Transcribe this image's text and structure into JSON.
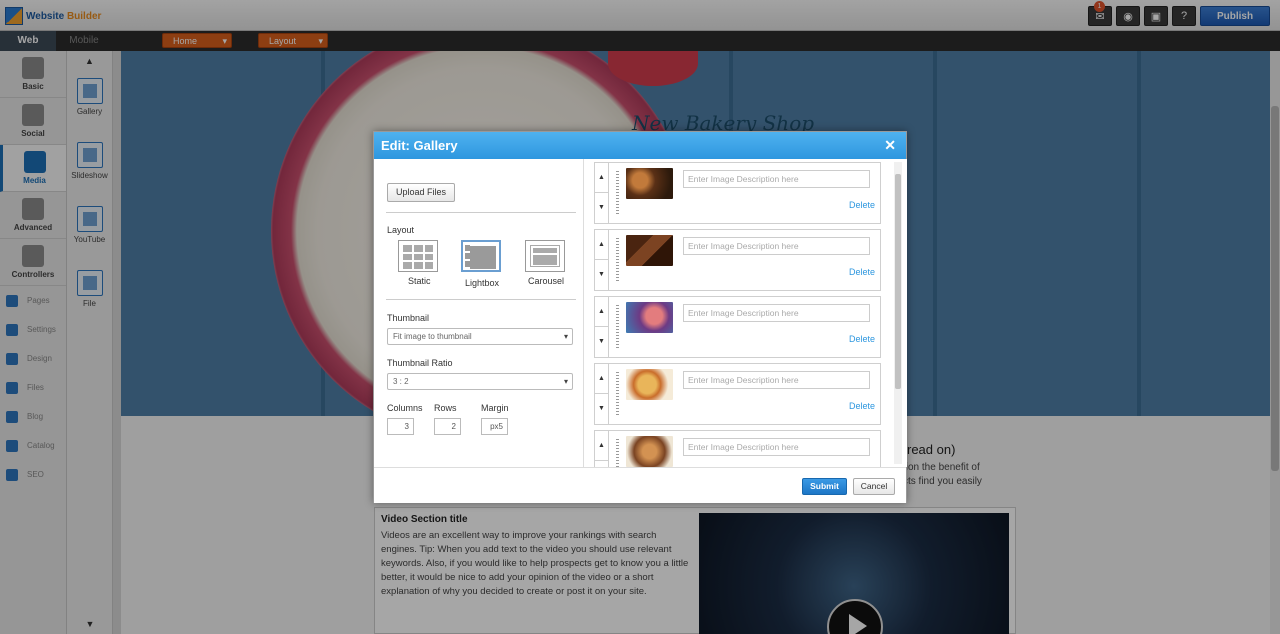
{
  "app": {
    "name_a": "Website",
    "name_b": "Builder",
    "notification_count": "1",
    "publish_label": "Publish"
  },
  "navbar": {
    "tabs": [
      "Web",
      "Mobile"
    ],
    "page_dropdown": "Home",
    "layout_dropdown": "Layout"
  },
  "sidebar": {
    "main": [
      {
        "label": "Basic",
        "icon": "flag-icon"
      },
      {
        "label": "Social",
        "icon": "chat-icon"
      },
      {
        "label": "Media",
        "icon": "media-icon",
        "active": true
      },
      {
        "label": "Advanced",
        "icon": "tools-icon"
      },
      {
        "label": "Controllers",
        "icon": "box-icon"
      }
    ],
    "links": [
      "Pages",
      "Settings",
      "Design",
      "Files",
      "Blog",
      "Catalog",
      "SEO"
    ],
    "media_items": [
      "Gallery",
      "Slideshow",
      "YouTube",
      "File"
    ]
  },
  "page": {
    "hero_title": "New Bakery Shop",
    "read_on": "read on)",
    "read_on_line1": "tion the benefit of",
    "read_on_line2": "cts find you easily",
    "video_title": "Video Section title",
    "video_text": "Videos are an excellent way to improve your rankings with search engines. Tip: When you add text to the video you should use relevant keywords. Also, if you would like to help prospects get to know you a little better, it would be nice to add your opinion of the video or a short explanation of why you decided to create or post it on your site."
  },
  "modal": {
    "title": "Edit: Gallery",
    "upload_label": "Upload Files",
    "layout_label": "Layout",
    "layouts": [
      "Static",
      "Lightbox",
      "Carousel"
    ],
    "selected_layout": "Lightbox",
    "thumbnail_label": "Thumbnail",
    "thumbnail_value": "Fit image to thumbnail",
    "ratio_label": "Thumbnail Ratio",
    "ratio_value": "3 : 2",
    "columns_label": "Columns",
    "rows_label": "Rows",
    "margin_label": "Margin",
    "columns_value": "3",
    "rows_value": "2",
    "margin_value": "px5",
    "desc_placeholder": "Enter Image Description here",
    "delete_label": "Delete",
    "submit_label": "Submit",
    "cancel_label": "Cancel"
  }
}
